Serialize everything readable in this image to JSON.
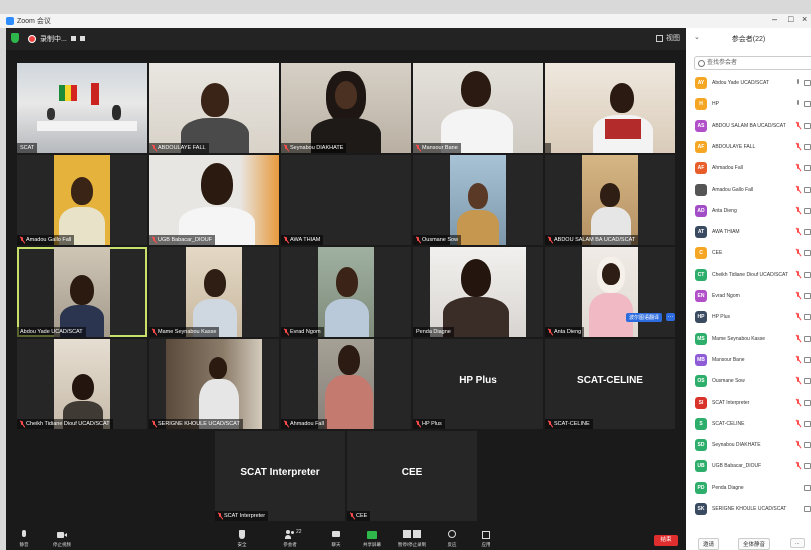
{
  "window": {
    "title": "Zoom 会议",
    "minimize": "–",
    "restore": "□",
    "close": "×"
  },
  "topbar": {
    "recording_label": "录制中...",
    "view_label": "视图"
  },
  "tiles": [
    {
      "name": "SCAT"
    },
    {
      "name": "ABDOULAYE FALL"
    },
    {
      "name": "Seynabou DIAKHATE"
    },
    {
      "name": "Mansour Bane"
    },
    {
      "name": ""
    },
    {
      "name": "Amadou Gallo Fall"
    },
    {
      "name": "UGB Babacar_DIOUF"
    },
    {
      "name": "AWA THIAM"
    },
    {
      "name": "Ousmane Sow"
    },
    {
      "name": "ABDOU SALAM BA UCAD/SCAT"
    },
    {
      "name": "Abdou Yade UCAD/SCAT"
    },
    {
      "name": "Mame Seynabou Kasse"
    },
    {
      "name": "Evrad Ngom"
    },
    {
      "name": "Penda Diagne"
    },
    {
      "name": "Anta Dieng"
    },
    {
      "name": "Cheikh Tidiane Diouf UCAD/SCAT"
    },
    {
      "name": "SERIGNE KHOULE UCAD/SCAT"
    },
    {
      "name": "Ahmadou Fall"
    },
    {
      "name": "HP Plus",
      "center": "HP Plus"
    },
    {
      "name": "SCAT-CELINE",
      "center": "SCAT-CELINE"
    },
    {
      "name": "SCAT Interpreter",
      "center": "SCAT Interpreter"
    },
    {
      "name": "CEE",
      "center": "CEE"
    }
  ],
  "interpretation_badge": "波尔图语翻译",
  "toolbar": {
    "mute": "静音",
    "video": "停止视频",
    "share_left": "安全",
    "participants": "参会者",
    "participants_count": "22",
    "chat": "聊天",
    "share": "共享屏幕",
    "record": "暂停/停止录制",
    "reactions": "反应",
    "apps": "应用",
    "end": "结束"
  },
  "panel": {
    "title": "参会者(22)",
    "search_placeholder": "查找参会者",
    "invite": "邀请",
    "mute_all": "全体静音",
    "more": "..."
  },
  "participants": [
    {
      "initials": "AY",
      "name": "Abdou Yade UCAD/SCAT",
      "color": "#f5a623",
      "mic": "on"
    },
    {
      "initials": "H",
      "name": "HP",
      "color": "#f5a623",
      "mic": "on"
    },
    {
      "initials": "AS",
      "name": "ABDOU SALAM BA UCAD/SCAT",
      "color": "#b04fc7",
      "mic": "off"
    },
    {
      "initials": "AF",
      "name": "ABDOULAYE FALL",
      "color": "#f5a623",
      "mic": "off"
    },
    {
      "initials": "AF",
      "name": "Ahmadou Fall",
      "color": "#e85d2a",
      "mic": "off"
    },
    {
      "initials": "",
      "name": "Amadou Gallo Fall",
      "color": "#555555",
      "mic": "off"
    },
    {
      "initials": "AD",
      "name": "Anta Dieng",
      "color": "#a24fc7",
      "mic": "off"
    },
    {
      "initials": "AT",
      "name": "AWA THIAM",
      "color": "#3a4a60",
      "mic": "off"
    },
    {
      "initials": "C",
      "name": "CEE",
      "color": "#f5a623",
      "mic": "off"
    },
    {
      "initials": "CT",
      "name": "Cheikh Tidiane Diouf UCAD/SCAT",
      "color": "#2eae6b",
      "mic": "off"
    },
    {
      "initials": "EN",
      "name": "Evrad Ngom",
      "color": "#b04fc7",
      "mic": "off"
    },
    {
      "initials": "HP",
      "name": "HP Plus",
      "color": "#3a4a60",
      "mic": "off"
    },
    {
      "initials": "MS",
      "name": "Mame Seynabou Kasse",
      "color": "#2eae6b",
      "mic": "off"
    },
    {
      "initials": "MB",
      "name": "Mansour Bane",
      "color": "#8f5bd6",
      "mic": "off"
    },
    {
      "initials": "OS",
      "name": "Ousmane Sow",
      "color": "#2eae6b",
      "mic": "off"
    },
    {
      "initials": "SI",
      "name": "SCAT Interpreter",
      "color": "#d9342b",
      "mic": "off"
    },
    {
      "initials": "S",
      "name": "SCAT-CELINE",
      "color": "#2eae6b",
      "mic": "off"
    },
    {
      "initials": "SD",
      "name": "Seynabou DIAKHATE",
      "color": "#2eae6b",
      "mic": "off"
    },
    {
      "initials": "UB",
      "name": "UGB Babacar_DIOUF",
      "color": "#2eae6b",
      "mic": "off"
    },
    {
      "initials": "PD",
      "name": "Penda Diagne",
      "color": "#2eae6b",
      "mic": "none"
    },
    {
      "initials": "SK",
      "name": "SERIGNE KHOULE UCAD/SCAT",
      "color": "#3a4a60",
      "mic": "none"
    }
  ]
}
